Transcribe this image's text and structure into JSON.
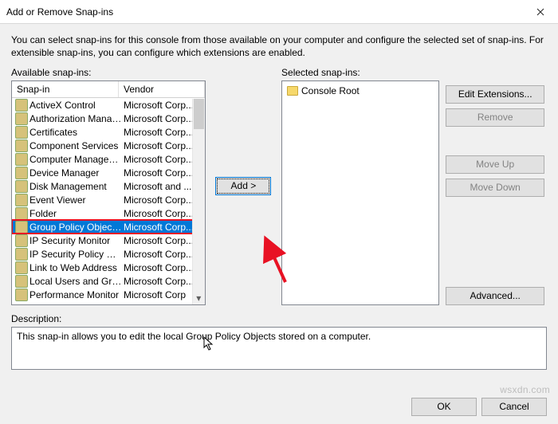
{
  "window": {
    "title": "Add or Remove Snap-ins",
    "intro": "You can select snap-ins for this console from those available on your computer and configure the selected set of snap-ins. For extensible snap-ins, you can configure which extensions are enabled."
  },
  "labels": {
    "available": "Available snap-ins:",
    "selected": "Selected snap-ins:",
    "description": "Description:",
    "snapin_col": "Snap-in",
    "vendor_col": "Vendor"
  },
  "buttons": {
    "add": "Add >",
    "edit_ext": "Edit Extensions...",
    "remove": "Remove",
    "move_up": "Move Up",
    "move_down": "Move Down",
    "advanced": "Advanced...",
    "ok": "OK",
    "cancel": "Cancel"
  },
  "available": [
    {
      "name": "ActiveX Control",
      "vendor": "Microsoft Corp..."
    },
    {
      "name": "Authorization Manager",
      "vendor": "Microsoft Corp..."
    },
    {
      "name": "Certificates",
      "vendor": "Microsoft Corp..."
    },
    {
      "name": "Component Services",
      "vendor": "Microsoft Corp..."
    },
    {
      "name": "Computer Managem...",
      "vendor": "Microsoft Corp..."
    },
    {
      "name": "Device Manager",
      "vendor": "Microsoft Corp..."
    },
    {
      "name": "Disk Management",
      "vendor": "Microsoft and ..."
    },
    {
      "name": "Event Viewer",
      "vendor": "Microsoft Corp..."
    },
    {
      "name": "Folder",
      "vendor": "Microsoft Corp..."
    },
    {
      "name": "Group Policy Object ...",
      "vendor": "Microsoft Corp..."
    },
    {
      "name": "IP Security Monitor",
      "vendor": "Microsoft Corp..."
    },
    {
      "name": "IP Security Policy Ma...",
      "vendor": "Microsoft Corp..."
    },
    {
      "name": "Link to Web Address",
      "vendor": "Microsoft Corp..."
    },
    {
      "name": "Local Users and Gro...",
      "vendor": "Microsoft Corp..."
    },
    {
      "name": "Performance Monitor",
      "vendor": "Microsoft Corp"
    }
  ],
  "selected_snapins": {
    "root": "Console Root"
  },
  "description_text": "This snap-in allows you to edit the local Group Policy Objects stored on a computer.",
  "watermark": "wsxdn.com"
}
